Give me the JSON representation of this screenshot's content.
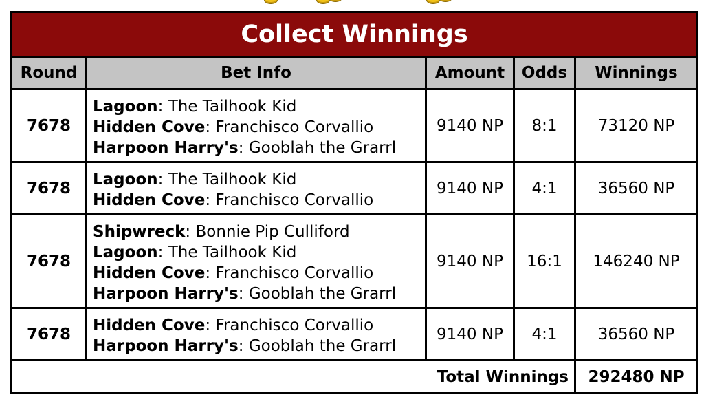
{
  "title": "Collect Winnings",
  "columns": [
    "Round",
    "Bet Info",
    "Amount",
    "Odds",
    "Winnings"
  ],
  "rows": [
    {
      "round": "7678",
      "bets": [
        {
          "track": "Lagoon",
          "pirate": "The Tailhook Kid"
        },
        {
          "track": "Hidden Cove",
          "pirate": "Franchisco Corvallio"
        },
        {
          "track": "Harpoon Harry's",
          "pirate": "Gooblah the Grarrl"
        }
      ],
      "amount": "9140 NP",
      "odds": "8:1",
      "winnings": "73120 NP"
    },
    {
      "round": "7678",
      "bets": [
        {
          "track": "Lagoon",
          "pirate": "The Tailhook Kid"
        },
        {
          "track": "Hidden Cove",
          "pirate": "Franchisco Corvallio"
        }
      ],
      "amount": "9140 NP",
      "odds": "4:1",
      "winnings": "36560 NP"
    },
    {
      "round": "7678",
      "bets": [
        {
          "track": "Shipwreck",
          "pirate": "Bonnie Pip Culliford"
        },
        {
          "track": "Lagoon",
          "pirate": "The Tailhook Kid"
        },
        {
          "track": "Hidden Cove",
          "pirate": "Franchisco Corvallio"
        },
        {
          "track": "Harpoon Harry's",
          "pirate": "Gooblah the Grarrl"
        }
      ],
      "amount": "9140 NP",
      "odds": "16:1",
      "winnings": "146240 NP"
    },
    {
      "round": "7678",
      "bets": [
        {
          "track": "Hidden Cove",
          "pirate": "Franchisco Corvallio"
        },
        {
          "track": "Harpoon Harry's",
          "pirate": "Gooblah the Grarrl"
        }
      ],
      "amount": "9140 NP",
      "odds": "4:1",
      "winnings": "36560 NP"
    }
  ],
  "total": {
    "label": "Total Winnings",
    "value": "292480 NP"
  },
  "colors": {
    "title_bg": "#8b0a0a",
    "header_bg": "#c4c4c4",
    "border": "#000000",
    "coin": "#f2c31a"
  },
  "icons": [
    "coin-icon"
  ]
}
